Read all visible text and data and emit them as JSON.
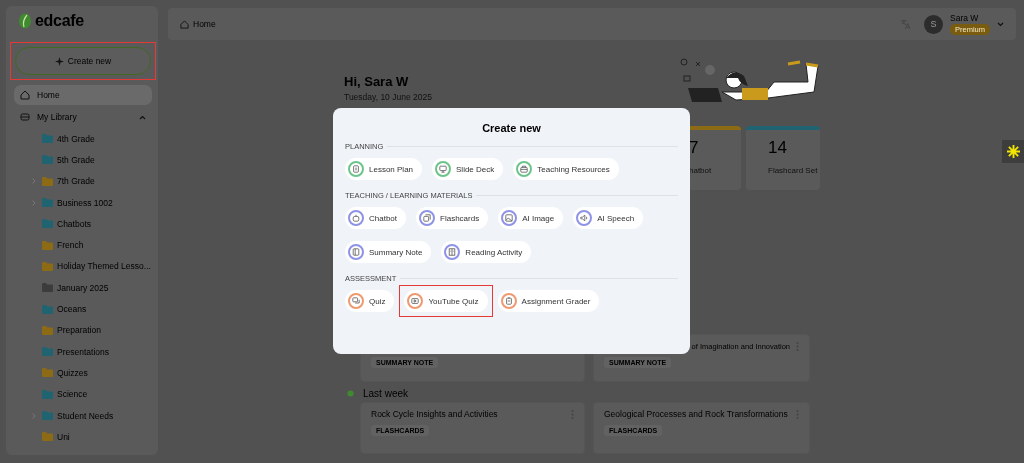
{
  "sidebar": {
    "logo": "edcafe",
    "create_button": {
      "label": "Create new",
      "highlighted": true
    },
    "nav": [
      {
        "label": "Home",
        "selected": true,
        "kind": "home"
      },
      {
        "label": "My Library",
        "selected": false,
        "kind": "library",
        "expanded": true
      }
    ],
    "folders": [
      {
        "label": "4th Grade",
        "color": "#1f6470",
        "expandable": false
      },
      {
        "label": "5th Grade",
        "color": "#1f6470",
        "expandable": false
      },
      {
        "label": "7th Grade",
        "color": "#8c6b14",
        "expandable": true
      },
      {
        "label": "Business 1002",
        "color": "#1f6470",
        "expandable": true
      },
      {
        "label": "Chatbots",
        "color": "#1f6470",
        "expandable": false
      },
      {
        "label": "French",
        "color": "#8c6b14",
        "expandable": false
      },
      {
        "label": "Holiday Themed Lesso...",
        "color": "#8c6b14",
        "expandable": false
      },
      {
        "label": "January 2025",
        "color": "#3c3c3c",
        "expandable": false
      },
      {
        "label": "Oceans",
        "color": "#1f6470",
        "expandable": false
      },
      {
        "label": "Preparation",
        "color": "#8c6b14",
        "expandable": false
      },
      {
        "label": "Presentations",
        "color": "#1f6470",
        "expandable": false
      },
      {
        "label": "Quizzes",
        "color": "#8c6b14",
        "expandable": false
      },
      {
        "label": "Science",
        "color": "#1f6470",
        "expandable": false
      },
      {
        "label": "Student Needs",
        "color": "#1f6470",
        "expandable": true
      },
      {
        "label": "Uni",
        "color": "#8c6b14",
        "expandable": false
      }
    ]
  },
  "header": {
    "breadcrumb": "Home",
    "user": {
      "avatar": "S",
      "name": "Sara W",
      "plan": "Premium"
    }
  },
  "greeting": {
    "title": "Hi, Sara W",
    "date": "Tuesday, 10 June 2025"
  },
  "stats": [
    {
      "value": "7",
      "label": "hatbot",
      "color": "#8c6b14"
    },
    {
      "value": "14",
      "label": "Flashcard Set",
      "color": "#1f6470"
    }
  ],
  "recent": [
    {
      "tag": "SUMMARY NOTE"
    },
    {
      "title": "of Imagination and Innovation",
      "tag": "SUMMARY NOTE"
    }
  ],
  "last_week": {
    "heading": "Last week",
    "items": [
      {
        "title": "Rock Cycle Insights and Activities",
        "tag": "FLASHCARDS"
      },
      {
        "title": "Geological Processes and Rock Transformations",
        "tag": "FLASHCARDS"
      }
    ]
  },
  "modal": {
    "title": "Create new",
    "sections": [
      {
        "label": "PLANNING",
        "color": "#6cc48a",
        "rows": [
          [
            {
              "label": "Lesson Plan",
              "highlighted": false
            },
            {
              "label": "Slide Deck",
              "highlighted": false
            },
            {
              "label": "Teaching Resources",
              "highlighted": false
            }
          ]
        ]
      },
      {
        "label": "TEACHING / LEARNING MATERIALS",
        "color": "#8f93e6",
        "rows": [
          [
            {
              "label": "Chatbot",
              "highlighted": false
            },
            {
              "label": "Flashcards",
              "highlighted": false
            },
            {
              "label": "AI Image",
              "highlighted": false
            },
            {
              "label": "AI Speech",
              "highlighted": false
            }
          ],
          [
            {
              "label": "Summary Note",
              "highlighted": false
            },
            {
              "label": "Reading Activity",
              "highlighted": false
            }
          ]
        ]
      },
      {
        "label": "ASSESSMENT",
        "color": "#ee9a70",
        "rows": [
          [
            {
              "label": "Quiz",
              "highlighted": false
            },
            {
              "label": "YouTube Quiz",
              "highlighted": true
            },
            {
              "label": "Assignment Grader",
              "highlighted": false
            }
          ]
        ]
      }
    ]
  }
}
